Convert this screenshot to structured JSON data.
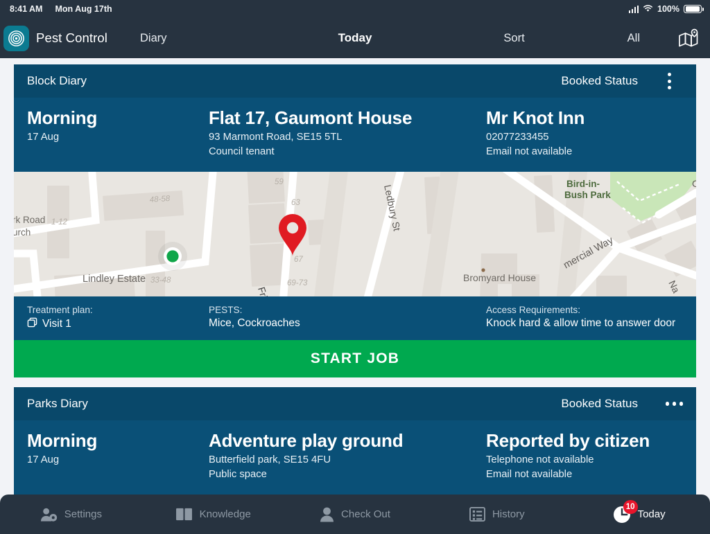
{
  "status_bar": {
    "time": "8:41 AM",
    "date": "Mon Aug 17th",
    "battery_percent": "100%",
    "signal_icon": "cellular-signal-icon",
    "wifi_icon": "wifi-icon",
    "battery_icon": "battery-full-icon"
  },
  "nav": {
    "logo_icon": "target-logo-icon",
    "brand": "Pest Control",
    "diary": "Diary",
    "today": "Today",
    "sort": "Sort",
    "all": "All",
    "map_icon": "map-pin-icon"
  },
  "colors": {
    "nav_bg": "#273340",
    "card_header_bg": "#09486a",
    "card_body_bg": "#0a5077",
    "accent_green": "#00a94f",
    "badge_red": "#e8152b",
    "logo_teal": "#0b7b91",
    "page_bg": "#f2f3f7"
  },
  "cards": [
    {
      "diary_label": "Block Diary",
      "status_label": "Booked Status",
      "menu_icon": "overflow-menu-vertical-icon",
      "when": "Morning",
      "when_date": "17 Aug",
      "site_title": "Flat 17, Gaumont House",
      "site_address": "93 Marmont Road, SE15 5TL",
      "site_type": "Council tenant",
      "contact_name": "Mr Knot Inn",
      "contact_phone": "02077233455",
      "contact_email": "Email not available",
      "treatment_label": "Treatment plan:",
      "treatment_value": "Visit 1",
      "treatment_icon": "copy-layers-icon",
      "pests_label": "PESTS:",
      "pests_value": "Mice, Cockroaches",
      "access_label": "Access Requirements:",
      "access_value": "Knock hard & allow time to answer door",
      "action_label": "START JOB",
      "map": {
        "pin_icon": "map-marker-red-icon",
        "user_location_icon": "current-location-dot-icon",
        "labels": [
          "rk Road",
          "urch",
          "1-12",
          "48-58",
          "59",
          "63",
          "67",
          "69-73",
          "33-48",
          "Lindley Estate",
          "Ledbury St",
          "Bromyard House",
          "Bird-in-",
          "Bush Park",
          "mercial Way",
          "Na"
        ]
      }
    },
    {
      "diary_label": "Parks Diary",
      "status_label": "Booked Status",
      "menu_icon": "overflow-menu-horizontal-icon",
      "when": "Morning",
      "when_date": "17 Aug",
      "site_title": "Adventure play ground",
      "site_address": "Butterfield park, SE15 4FU",
      "site_type": "Public space",
      "contact_name": "Reported by citizen",
      "contact_phone": "Telephone not available",
      "contact_email": "Email not available"
    }
  ],
  "tabs": [
    {
      "label": "Settings",
      "icon": "user-settings-icon",
      "active": false
    },
    {
      "label": "Knowledge",
      "icon": "open-book-icon",
      "active": false
    },
    {
      "label": "Check Out",
      "icon": "person-icon",
      "active": false
    },
    {
      "label": "History",
      "icon": "list-icon",
      "active": false
    },
    {
      "label": "Today",
      "icon": "clock-icon",
      "active": true,
      "badge": "10"
    }
  ]
}
